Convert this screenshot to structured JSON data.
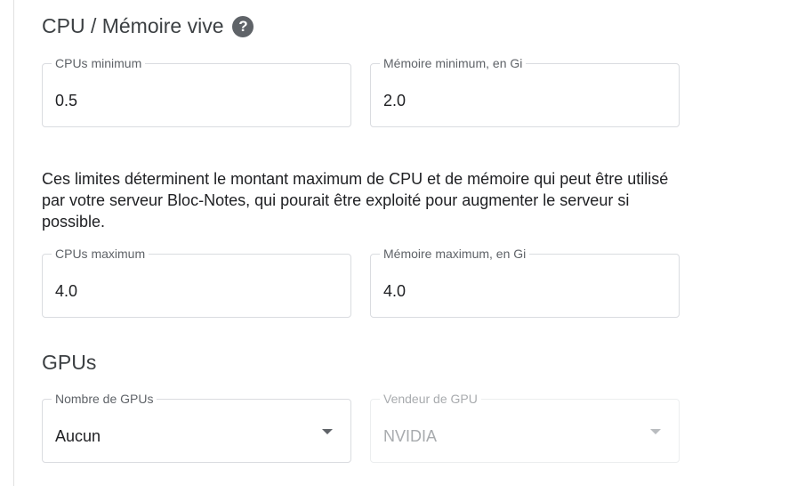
{
  "cpu_memory": {
    "title": "CPU / Mémoire vive",
    "help_icon_glyph": "?",
    "cpu_min": {
      "label": "CPUs minimum",
      "value": "0.5"
    },
    "mem_min": {
      "label": "Mémoire minimum, en Gi",
      "value": "2.0"
    },
    "description": "Ces limites déterminent le montant maximum de CPU et de mémoire qui peut être utilisé par votre serveur Bloc-Notes, qui pourait être exploité pour augmenter le serveur si possible.",
    "cpu_max": {
      "label": "CPUs maximum",
      "value": "4.0"
    },
    "mem_max": {
      "label": "Mémoire maximum, en Gi",
      "value": "4.0"
    }
  },
  "gpus": {
    "title": "GPUs",
    "count": {
      "label": "Nombre de GPUs",
      "value": "Aucun",
      "disabled": false
    },
    "vendor": {
      "label": "Vendeur de GPU",
      "value": "NVIDIA",
      "disabled": true
    }
  },
  "colors": {
    "text": "#202124",
    "label": "#5f6368",
    "border": "#dadce0",
    "disabled_text": "#a8abae",
    "help_icon_bg": "#5f6368"
  },
  "icons": {
    "help": "help-circle-icon",
    "dropdown": "arrow-drop-down-icon"
  }
}
